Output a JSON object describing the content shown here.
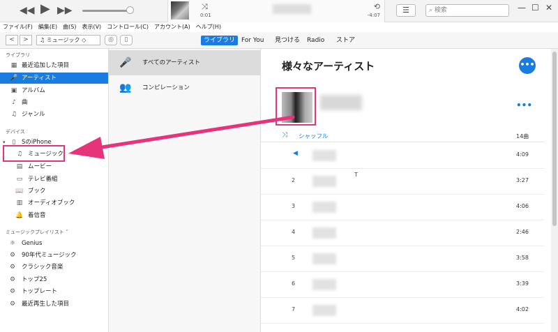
{
  "player": {
    "rewind_icon": "◀◀",
    "play_icon": "▶",
    "forward_icon": "▶▶",
    "elapsed": "0:01",
    "remaining": "-4:07",
    "shuffle_icon": "⤨",
    "repeat_icon": "⟲",
    "list_view_icon": "☰",
    "search_placeholder": "⌕ 検索",
    "win_min": "—",
    "win_max": "☐",
    "win_close": "✕"
  },
  "menu": [
    "ファイル(F)",
    "編集(E)",
    "曲(S)",
    "表示(V)",
    "コントロール(C)",
    "アカウント(A)",
    "ヘルプ(H)"
  ],
  "nav": {
    "back": "<",
    "forward": ">",
    "media_select": "♫ ミュージック ◇",
    "tabs": [
      "ライブラリ",
      "For You",
      "見つける",
      "Radio",
      "ストア"
    ],
    "active_tab": "ライブラリ"
  },
  "sidebar": {
    "library_header": "ライブラリ",
    "library": [
      {
        "label": "最近追加した項目",
        "icon": "▦"
      },
      {
        "label": "アーティスト",
        "icon": "🎤"
      },
      {
        "label": "アルバム",
        "icon": "▣"
      },
      {
        "label": "曲",
        "icon": "♪"
      },
      {
        "label": "ジャンル",
        "icon": "♫"
      }
    ],
    "devices_header": "デバイス",
    "device_name": "SのiPhone",
    "device_items": [
      {
        "label": "ミュージック",
        "icon": "♫"
      },
      {
        "label": "ムービー",
        "icon": "▤"
      },
      {
        "label": "テレビ番組",
        "icon": "▭"
      },
      {
        "label": "ブック",
        "icon": "📖"
      },
      {
        "label": "オーディオブック",
        "icon": "▥"
      },
      {
        "label": "着信音",
        "icon": "🔔"
      }
    ],
    "playlists_header": "ミュージックプレイリスト ˅",
    "playlists": [
      {
        "label": "Genius",
        "icon": "⚛"
      },
      {
        "label": "90年代ミュージック",
        "icon": "⚙"
      },
      {
        "label": "クラシック音楽",
        "icon": "⚙"
      },
      {
        "label": "トップ25",
        "icon": "⚙"
      },
      {
        "label": "トップレート",
        "icon": "⚙"
      },
      {
        "label": "最近再生した項目",
        "icon": "⚙"
      }
    ]
  },
  "artists": [
    {
      "label": "すべてのアーティスト",
      "icon": "🎤"
    },
    {
      "label": "コンピレーション",
      "icon": "👥"
    }
  ],
  "main": {
    "title": "様々なアーティスト",
    "more": "•••",
    "album_more": "•••",
    "shuffle_label": "シャッフル",
    "track_count": "14曲",
    "tracks": [
      {
        "num": "",
        "time": "4:09",
        "suffix": ""
      },
      {
        "num": "2",
        "time": "3:27",
        "suffix": "T"
      },
      {
        "num": "3",
        "time": "4:06",
        "suffix": ""
      },
      {
        "num": "4",
        "time": "2:46",
        "suffix": ""
      },
      {
        "num": "5",
        "time": "3:58",
        "suffix": ""
      },
      {
        "num": "6",
        "time": "3:39",
        "suffix": ""
      },
      {
        "num": "7",
        "time": "4:02",
        "suffix": ""
      }
    ]
  },
  "colors": {
    "accent": "#1a7be0",
    "highlight": "#e6337a"
  }
}
